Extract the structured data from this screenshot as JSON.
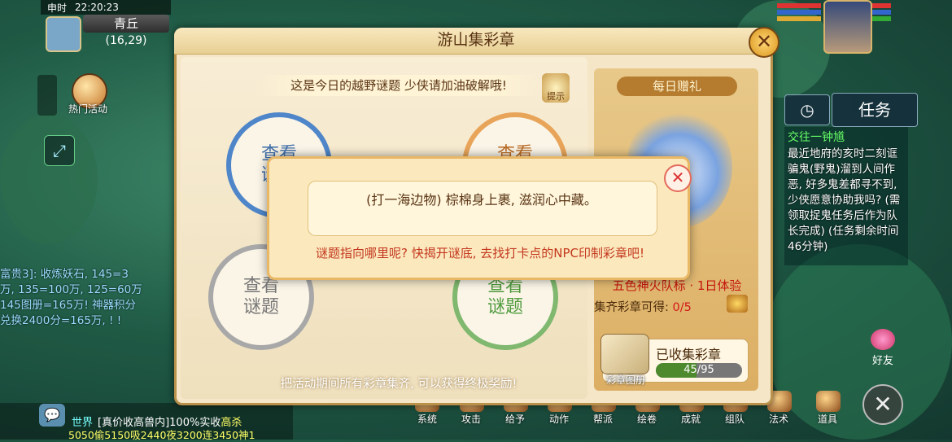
{
  "hud": {
    "time_label": "申时",
    "clock": "22:20:23",
    "map_name": "青丘",
    "coords": "(16,29)",
    "hot_activity": "热门活动"
  },
  "chat_overlay": {
    "lines": [
      "富贵3]:  收炼妖石, 145=3",
      "万, 135=100万, 125=60万",
      "145图册=165万! 神器积分",
      "兑换2400分=165万, ! !"
    ]
  },
  "world_chat": {
    "channel": "世界",
    "message": "[真价收高兽内]100%实收",
    "highlight": "高杀",
    "line2": "5050偷5150吸2440夜3200连3450神1"
  },
  "bottom_menu": {
    "items": [
      "系统",
      "攻击",
      "给予",
      "动作",
      "帮派",
      "绘卷",
      "成就",
      "组队",
      "法术",
      "道具"
    ]
  },
  "task_panel": {
    "tab_label": "任务",
    "task_title": "交往一钟馗",
    "task_desc": "最近地府的亥时二刻诓骗鬼(野鬼)溜到人间作恶, 好多鬼差都寻不到, 少侠愿意协助我吗? (需领取捉鬼任务后作为队长完成) (任务剩余时间46分钟)"
  },
  "friend_label": "好友",
  "dialog": {
    "title": "游山集彩章",
    "hint_banner": "这是今日的越野谜题 少侠请加油破解哦!",
    "hint_button": "提示",
    "circles": [
      {
        "label": "查看\n谜题"
      },
      {
        "label": "查看\n谜题"
      },
      {
        "label": "查看\n谜题"
      },
      {
        "label": "查看\n谜题"
      }
    ],
    "bottom_hint": "把活动期间所有彩章集齐, 可以获得终极奖励!"
  },
  "reward": {
    "daily_gift": "每日赠礼",
    "reward_name": "五色神火队标 · 1日体验",
    "progress_label": "集齐彩章可得:",
    "progress_value": "0/5",
    "collected_label": "已收集彩章",
    "collected_count": "45/95",
    "collected_fraction": 0.4737,
    "stamp_book_label": "彩章图册"
  },
  "riddle": {
    "text": "(打一海边物) 棕棉身上裹, 滋润心中藏。",
    "hint": "谜题指向哪里呢? 快揭开谜底, 去找打卡点的NPC印制彩章吧!"
  },
  "colors": {
    "dialog_bg": "#f4e6c7",
    "accent_red": "#c4160e",
    "blue_circle": "#4f86c9",
    "orange_circle": "#e8a55a",
    "gray_circle": "#a8a8a8",
    "green_circle": "#7fb86e"
  }
}
